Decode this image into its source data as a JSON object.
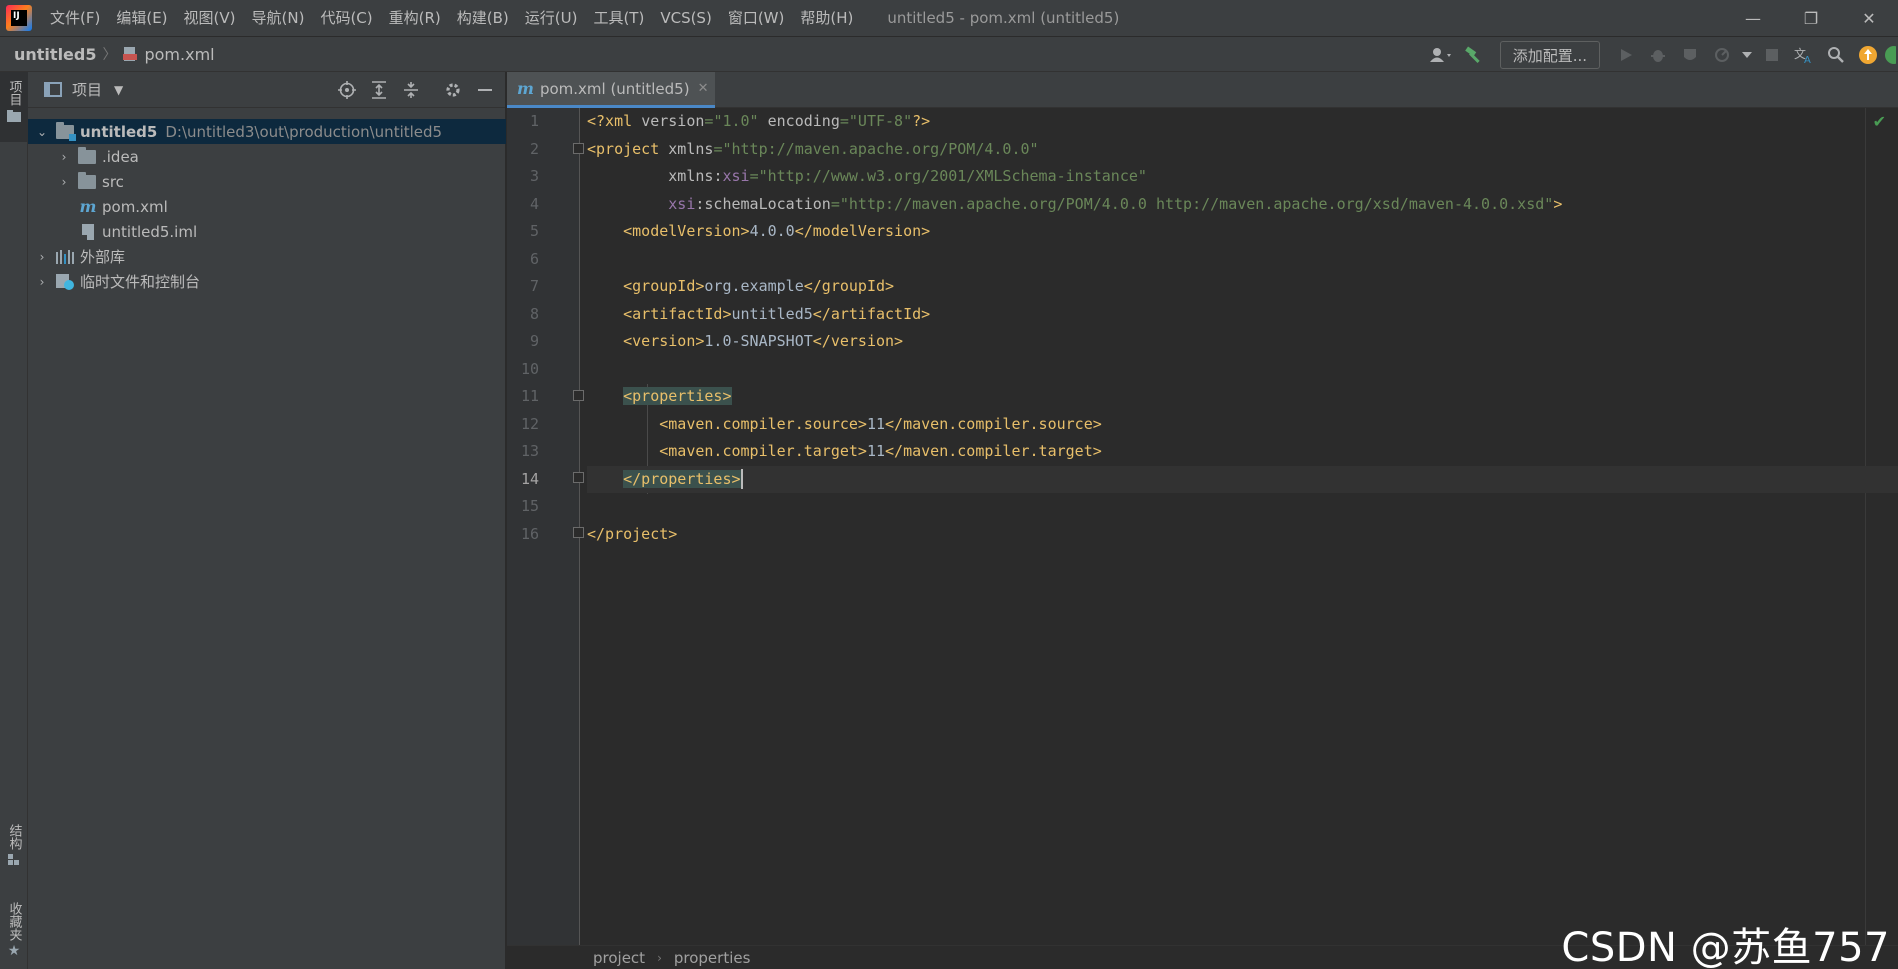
{
  "titlebar": {
    "logo_text": "IJ",
    "menu": [
      "文件(F)",
      "编辑(E)",
      "视图(V)",
      "导航(N)",
      "代码(C)",
      "重构(R)",
      "构建(B)",
      "运行(U)",
      "工具(T)",
      "VCS(S)",
      "窗口(W)",
      "帮助(H)"
    ],
    "window_title": "untitled5 - pom.xml (untitled5)",
    "controls": {
      "minimize": "—",
      "restore": "❐",
      "close": "✕"
    }
  },
  "navbar": {
    "project": "untitled5",
    "separator": "〉",
    "file": "pom.xml",
    "add_config_label": "添加配置..."
  },
  "left_stripe": {
    "project_tab": "项目",
    "structure_tab": "结构",
    "favorites_tab": "收藏夹"
  },
  "project_panel": {
    "title": "项目",
    "tree": [
      {
        "label": "untitled5",
        "path": "D:\\untitled3\\out\\production\\untitled5"
      },
      {
        "label": ".idea"
      },
      {
        "label": "src"
      },
      {
        "label": "pom.xml"
      },
      {
        "label": "untitled5.iml"
      },
      {
        "label": "外部库"
      },
      {
        "label": "临时文件和控制台"
      }
    ]
  },
  "editor": {
    "tab_label": "pom.xml (untitled5)",
    "current_line": 14,
    "line_numbers": [
      "1",
      "2",
      "3",
      "4",
      "5",
      "6",
      "7",
      "8",
      "9",
      "10",
      "11",
      "12",
      "13",
      "14",
      "15",
      "16"
    ],
    "code": {
      "l1": {
        "a": "<?xml ",
        "b": "version",
        "c": "=",
        "d": "\"1.0\"",
        "e": " encoding",
        "f": "=",
        "g": "\"UTF-8\"",
        "h": "?>"
      },
      "l2": {
        "a": "<project ",
        "b": "xmlns",
        "c": "=",
        "d": "\"http://maven.apache.org/POM/4.0.0\""
      },
      "l3": {
        "indent": "         ",
        "a": "xmlns",
        "b": ":",
        "c": "xsi",
        "d": "=",
        "e": "\"http://www.w3.org/2001/XMLSchema-instance\""
      },
      "l4": {
        "indent": "         ",
        "a": "xsi",
        "b": ":schemaLocation",
        "c": "=",
        "d": "\"http://maven.apache.org/POM/4.0.0 http://maven.apache.org/xsd/maven-4.0.0.xsd\"",
        "e": ">"
      },
      "l5": {
        "indent": "    ",
        "a": "<modelVersion>",
        "b": "4.0.0",
        "c": "</modelVersion>"
      },
      "l7": {
        "indent": "    ",
        "a": "<groupId>",
        "b": "org.example",
        "c": "</groupId>"
      },
      "l8": {
        "indent": "    ",
        "a": "<artifactId>",
        "b": "untitled5",
        "c": "</artifactId>"
      },
      "l9": {
        "indent": "    ",
        "a": "<version>",
        "b": "1.0-SNAPSHOT",
        "c": "</version>"
      },
      "l11": {
        "indent": "    ",
        "a": "<properties>"
      },
      "l12": {
        "indent": "        ",
        "a": "<maven.compiler.source>",
        "b": "11",
        "c": "</maven.compiler.source>"
      },
      "l13": {
        "indent": "        ",
        "a": "<maven.compiler.target>",
        "b": "11",
        "c": "</maven.compiler.target>"
      },
      "l14": {
        "indent": "    ",
        "a": "</properties>"
      },
      "l16": {
        "a": "</project>"
      }
    },
    "breadcrumb": [
      "project",
      "properties"
    ]
  },
  "watermark": "CSDN @苏鱼757",
  "colors": {
    "accent": "#4a88c7",
    "selection": "#0d293e",
    "tag": "#e8bf6a",
    "string": "#6a8759"
  }
}
